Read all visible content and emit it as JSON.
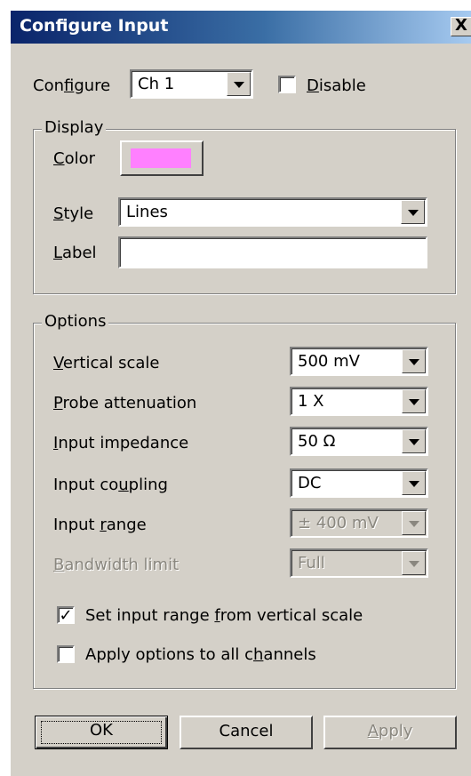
{
  "window": {
    "title": "Configure Input",
    "close_label": "X"
  },
  "configure": {
    "label": "Configure",
    "channel": "Ch 1",
    "disable_label": "Disable",
    "disable_checked": false
  },
  "display": {
    "group_title": "Display",
    "color_label": "Color",
    "color_value": "#ff80ff",
    "style_label": "Style",
    "style_value": "Lines",
    "label_label": "Label",
    "label_value": ""
  },
  "options": {
    "group_title": "Options",
    "vertical_scale": {
      "label": "Vertical scale",
      "value": "500 mV"
    },
    "probe_attenuation": {
      "label": "Probe attenuation",
      "value": "1 X"
    },
    "input_impedance": {
      "label": "Input impedance",
      "value": "50 Ω"
    },
    "input_coupling": {
      "label": "Input coupling",
      "value": "DC"
    },
    "input_range": {
      "label": "Input range",
      "value": "± 400 mV"
    },
    "bandwidth_limit": {
      "label": "Bandwidth limit",
      "value": "Full"
    },
    "set_range_label": "Set input range from vertical scale",
    "set_range_checked": true,
    "apply_all_label": "Apply options to all channels",
    "apply_all_checked": false
  },
  "buttons": {
    "ok": "OK",
    "cancel": "Cancel",
    "apply": "Apply"
  }
}
